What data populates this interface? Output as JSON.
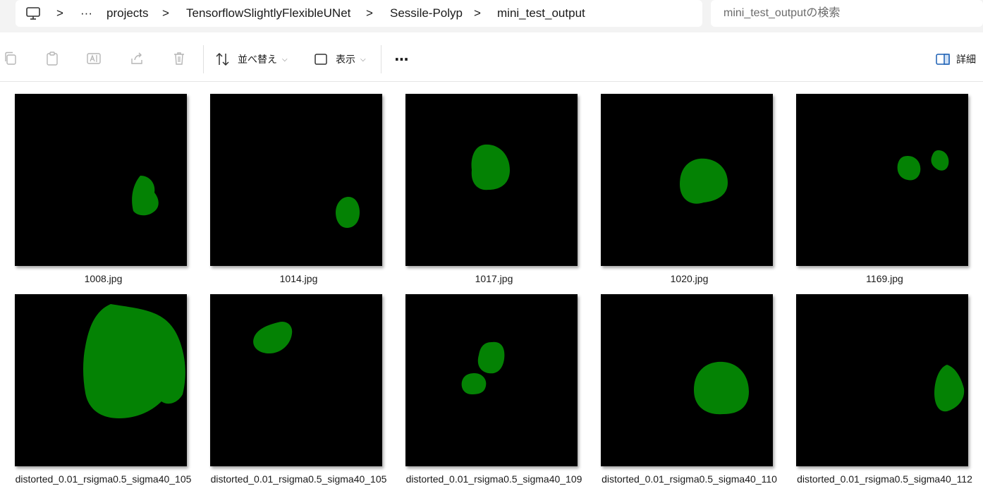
{
  "address_bar": {
    "overflow": "···",
    "crumbs": [
      "projects",
      "TensorflowSlightlyFlexibleUNet",
      "Sessile-Polyp",
      "mini_test_output"
    ],
    "separator": ">"
  },
  "search": {
    "placeholder": "mini_test_outputの検索"
  },
  "toolbar": {
    "sort_label": "並べ替え",
    "view_label": "表示",
    "more_label": "···",
    "details_label": "詳細"
  },
  "colors": {
    "mask": "#048204",
    "tile_bg": "#000000"
  },
  "files": [
    {
      "name": "1008.jpg"
    },
    {
      "name": "1014.jpg"
    },
    {
      "name": "1017.jpg"
    },
    {
      "name": "1020.jpg"
    },
    {
      "name": "1169.jpg"
    },
    {
      "name": "distorted_0.01_rsigma0.5_sigma40_105"
    },
    {
      "name": "distorted_0.01_rsigma0.5_sigma40_105"
    },
    {
      "name": "distorted_0.01_rsigma0.5_sigma40_109"
    },
    {
      "name": "distorted_0.01_rsigma0.5_sigma40_110"
    },
    {
      "name": "distorted_0.01_rsigma0.5_sigma40_112"
    }
  ]
}
